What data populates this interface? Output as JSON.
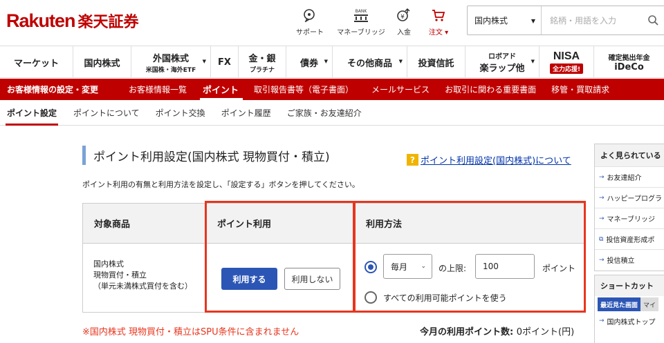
{
  "header": {
    "logo_en": "Rakuten",
    "logo_ja": "楽天証券",
    "icons": [
      {
        "label": "サポート",
        "icon": "support-chat-icon"
      },
      {
        "label": "マネーブリッジ",
        "icon": "bank-bridge-icon",
        "icon_text": "BANK"
      },
      {
        "label": "入金",
        "icon": "deposit-icon"
      },
      {
        "label": "注文 ▾",
        "icon": "cart-icon"
      }
    ],
    "search": {
      "category": "国内株式",
      "placeholder": "銘柄・用語を入力"
    }
  },
  "global_nav": [
    {
      "label": "マーケット"
    },
    {
      "label": "国内株式"
    },
    {
      "label": "外国株式",
      "sub": "米国株・海外ETF"
    },
    {
      "label": "FX"
    },
    {
      "label": "金・銀",
      "sub": "プラチナ"
    },
    {
      "label": "債券"
    },
    {
      "label": "その他商品"
    },
    {
      "label": "投資信託"
    },
    {
      "top": "ロボアド",
      "label": "楽ラップ他"
    },
    {
      "label": "NISA",
      "badge": "全力応援!"
    },
    {
      "top": "確定拠出年金",
      "label": "iDeCo"
    }
  ],
  "red_nav": [
    "お客様情報の設定・変更",
    "お客様情報一覧",
    "ポイント",
    "取引報告書等（電子書面）",
    "メールサービス",
    "お取引に関わる重要書面",
    "移管・買取請求"
  ],
  "sub_nav": [
    "ポイント設定",
    "ポイントについて",
    "ポイント交換",
    "ポイント履歴",
    "ご家族・お友達紹介"
  ],
  "main": {
    "title": "ポイント利用設定(国内株式 現物買付・積立)",
    "help_icon": "?",
    "help_link": "ポイント利用設定(国内株式)について",
    "description": "ポイント利用の有無と利用方法を設定し、「設定する」ボタンを押してください。",
    "table": {
      "headers": [
        "対象商品",
        "ポイント利用",
        "利用方法"
      ],
      "product": [
        "国内株式",
        "現物買付・積立",
        "（単元未満株式買付を含む）"
      ],
      "use_button": "利用する",
      "no_use_button": "利用しない",
      "frequency": "毎月",
      "limit_label": "の上限:",
      "limit_value": "100",
      "point_unit": "ポイント",
      "use_all_label": "すべての利用可能ポイントを使う"
    },
    "warning": "※国内株式 現物買付・積立はSPU条件に含まれません",
    "monthly_label": "今月の利用ポイント数:",
    "monthly_value": "0ポイント(円)"
  },
  "sidebar": {
    "popular_title": "よく見られている",
    "popular": [
      "お友達紹介",
      "ハッピープログラ",
      "マネーブリッジ",
      "投信資産形成ポ",
      "投信積立"
    ],
    "shortcut_title": "ショートカット",
    "shortcut_tabs": [
      "最近見た画面",
      "マイ"
    ],
    "shortcut_items": [
      "国内株式トップ"
    ]
  },
  "colors": {
    "brand_red": "#bf0000",
    "accent_blue": "#2c56b5",
    "highlight_orange": "#e8351e"
  }
}
